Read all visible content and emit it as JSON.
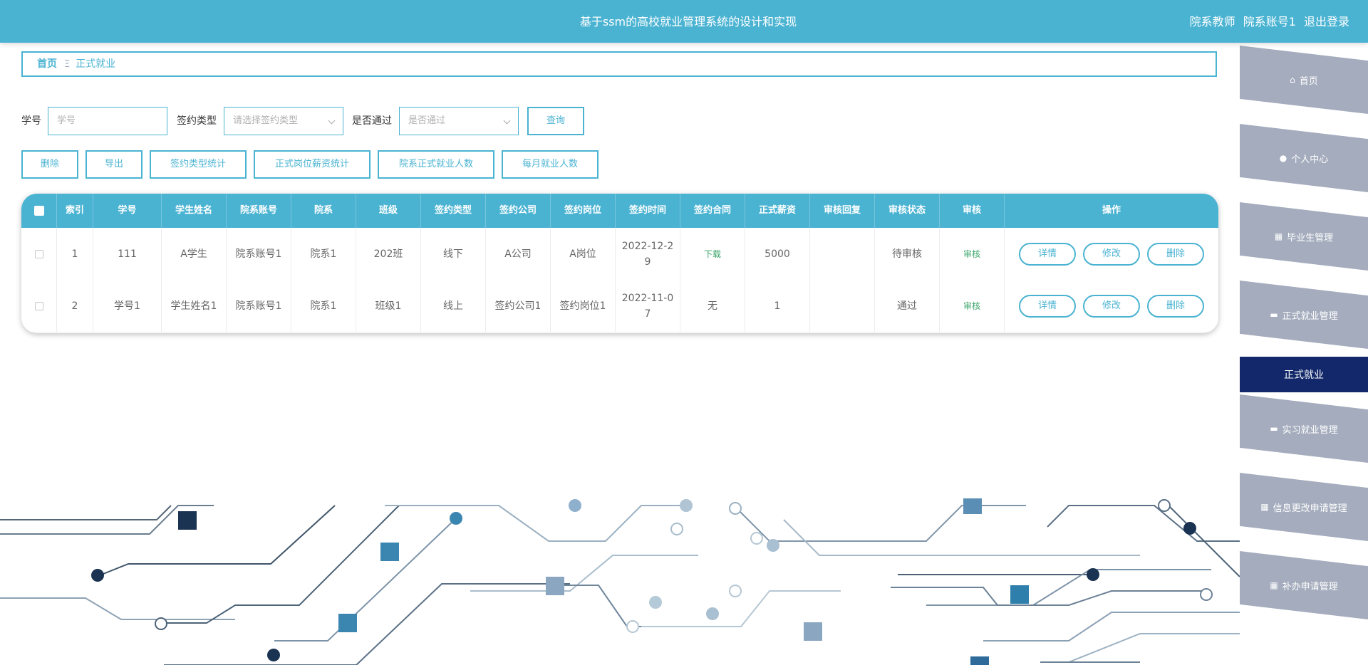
{
  "header": {
    "title": "基于ssm的高校就业管理系统的设计和实现",
    "role": "院系教师",
    "account": "院系账号1",
    "logout": "退出登录"
  },
  "breadcrumb": {
    "home": "首页",
    "separator": "Ξ",
    "current": "正式就业"
  },
  "search": {
    "student_no_label": "学号",
    "student_no_placeholder": "学号",
    "sign_type_label": "签约类型",
    "sign_type_placeholder": "请选择签约类型",
    "passed_label": "是否通过",
    "passed_placeholder": "是否通过",
    "query_button": "查询"
  },
  "actions": {
    "delete": "删除",
    "export": "导出",
    "sign_type_stats": "签约类型统计",
    "salary_stats": "正式岗位薪资统计",
    "dept_count": "院系正式就业人数",
    "monthly_count": "每月就业人数"
  },
  "table": {
    "headers": [
      "索引",
      "学号",
      "学生姓名",
      "院系账号",
      "院系",
      "班级",
      "签约类型",
      "签约公司",
      "签约岗位",
      "签约时间",
      "签约合同",
      "正式薪资",
      "审核回复",
      "审核状态",
      "审核",
      "操作"
    ],
    "rows": [
      {
        "index": "1",
        "student_no": "111",
        "student_name": "A学生",
        "dept_account": "院系账号1",
        "dept": "院系1",
        "class": "202班",
        "sign_type": "线下",
        "company": "A公司",
        "position": "A岗位",
        "sign_time": "2022-12-29",
        "contract": "下载",
        "salary": "5000",
        "reply": "",
        "status": "待审核",
        "review": "审核"
      },
      {
        "index": "2",
        "student_no": "学号1",
        "student_name": "学生姓名1",
        "dept_account": "院系账号1",
        "dept": "院系1",
        "class": "班级1",
        "sign_type": "线上",
        "company": "签约公司1",
        "position": "签约岗位1",
        "sign_time": "2022-11-07",
        "contract": "无",
        "salary": "1",
        "reply": "",
        "status": "通过",
        "review": "审核"
      }
    ],
    "ops": {
      "detail": "详情",
      "edit": "修改",
      "delete": "删除"
    }
  },
  "sidebar": {
    "items": [
      {
        "label": "首页",
        "icon": "home-icon"
      },
      {
        "label": "个人中心",
        "icon": "user-icon"
      },
      {
        "label": "毕业生管理",
        "icon": "grid-icon"
      },
      {
        "label": "正式就业管理",
        "icon": "monitor-icon"
      },
      {
        "label": "正式就业",
        "icon": ""
      },
      {
        "label": "实习就业管理",
        "icon": "monitor-icon"
      },
      {
        "label": "信息更改申请管理",
        "icon": "grid-icon"
      },
      {
        "label": "补办申请管理",
        "icon": "grid-icon"
      }
    ]
  },
  "colors": {
    "accent": "#4ab3d2",
    "sidebar": "#a4acbd",
    "active": "#12286a"
  }
}
